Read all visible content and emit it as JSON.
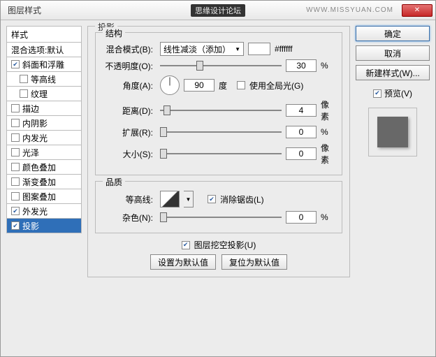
{
  "window": {
    "title": "图层样式",
    "brand": "思缘设计论坛",
    "brand_url": "WWW.MISSYUAN.COM"
  },
  "sidebar": {
    "header": "样式",
    "blending": "混合选项:默认",
    "items": [
      {
        "label": "斜面和浮雕",
        "checked": true,
        "selected": false,
        "indent": false
      },
      {
        "label": "等高线",
        "checked": false,
        "selected": false,
        "indent": true
      },
      {
        "label": "纹理",
        "checked": false,
        "selected": false,
        "indent": true
      },
      {
        "label": "描边",
        "checked": false,
        "selected": false,
        "indent": false
      },
      {
        "label": "内阴影",
        "checked": false,
        "selected": false,
        "indent": false
      },
      {
        "label": "内发光",
        "checked": false,
        "selected": false,
        "indent": false
      },
      {
        "label": "光泽",
        "checked": false,
        "selected": false,
        "indent": false
      },
      {
        "label": "颜色叠加",
        "checked": false,
        "selected": false,
        "indent": false
      },
      {
        "label": "渐变叠加",
        "checked": false,
        "selected": false,
        "indent": false
      },
      {
        "label": "图案叠加",
        "checked": false,
        "selected": false,
        "indent": false
      },
      {
        "label": "外发光",
        "checked": true,
        "selected": false,
        "indent": false
      },
      {
        "label": "投影",
        "checked": true,
        "selected": true,
        "indent": false
      }
    ]
  },
  "main": {
    "group_title": "投影",
    "structure": {
      "title": "结构",
      "blend_mode": {
        "label": "混合模式(B):",
        "value": "线性减淡（添加）",
        "color_text": "#ffffff"
      },
      "opacity": {
        "label": "不透明度(O):",
        "value": "30",
        "unit": "%"
      },
      "angle": {
        "label": "角度(A):",
        "value": "90",
        "unit": "度",
        "global": "使用全局光(G)",
        "global_checked": false
      },
      "distance": {
        "label": "距离(D):",
        "value": "4",
        "unit": "像素"
      },
      "spread": {
        "label": "扩展(R):",
        "value": "0",
        "unit": "%"
      },
      "size": {
        "label": "大小(S):",
        "value": "0",
        "unit": "像素"
      }
    },
    "quality": {
      "title": "品质",
      "contour": {
        "label": "等高线:",
        "antialias": "消除锯齿(L)",
        "antialias_checked": true
      },
      "noise": {
        "label": "杂色(N):",
        "value": "0",
        "unit": "%"
      }
    },
    "knockout": {
      "label": "图层挖空投影(U)",
      "checked": true
    },
    "defaults": {
      "make": "设置为默认值",
      "reset": "复位为默认值"
    }
  },
  "right": {
    "ok": "确定",
    "cancel": "取消",
    "new_style": "新建样式(W)...",
    "preview": "预览(V)",
    "preview_checked": true
  }
}
